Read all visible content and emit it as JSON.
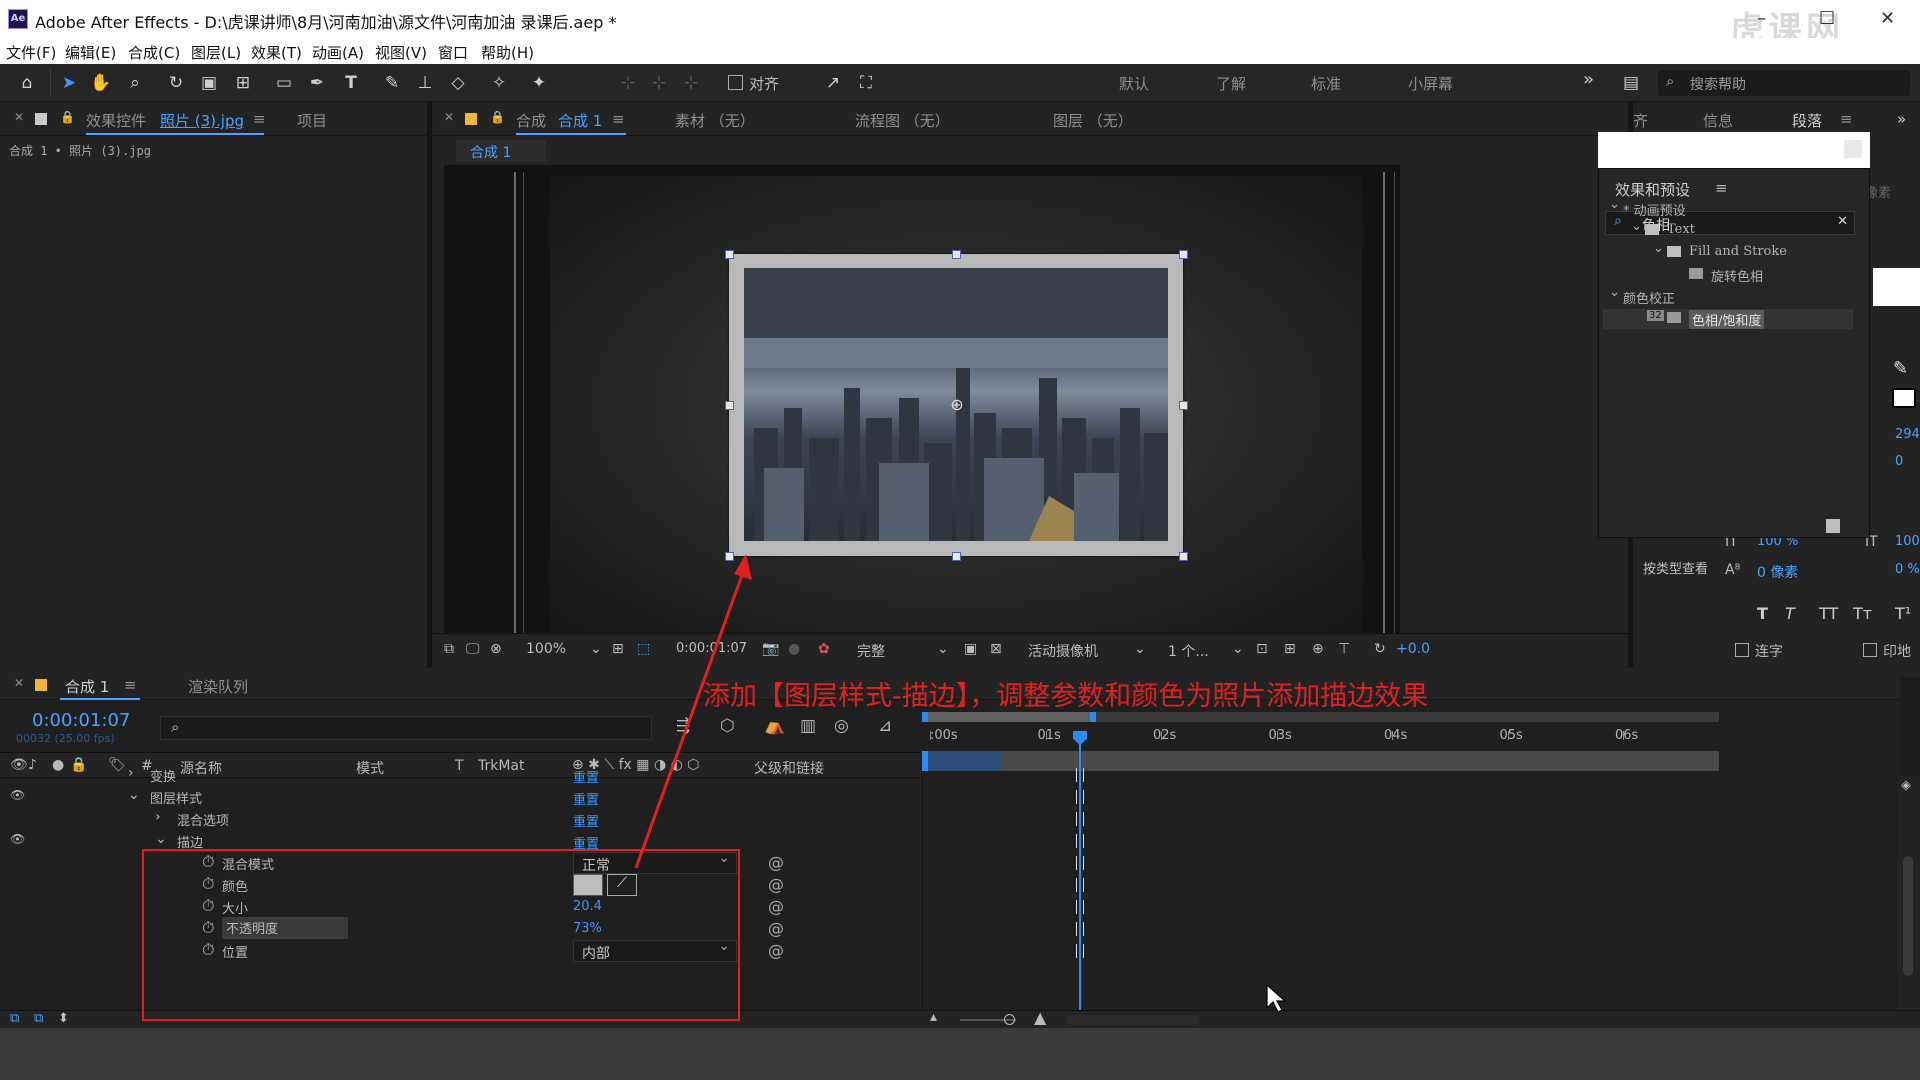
{
  "window": {
    "app_icon": "Ae",
    "title": "Adobe After Effects - D:\\虎课讲师\\8月\\河南加油\\源文件\\河南加油 录课后.aep *",
    "watermark": "虎课网"
  },
  "menu": [
    "文件(F)",
    "编辑(E)",
    "合成(C)",
    "图层(L)",
    "效果(T)",
    "动画(A)",
    "视图(V)",
    "窗口",
    "帮助(H)"
  ],
  "toolbar": {
    "align_label": "对齐",
    "workspaces": [
      "默认",
      "了解",
      "标准",
      "小屏幕"
    ],
    "search_placeholder": "搜索帮助",
    "more": "»"
  },
  "effect_controls": {
    "tab_prefix": "效果控件",
    "tab_layer": "照片 (3).jpg",
    "tab_project": "项目",
    "breadcrumb": "合成 1 • 照片 (3).jpg"
  },
  "composition": {
    "tab_prefix": "合成",
    "tab_name": "合成 1",
    "other_tabs": [
      "素材 （无）",
      "流程图 （无）",
      "图层 （无）"
    ],
    "subtab": "合成 1",
    "zoom": "100%",
    "timecode": "0:00:01:07",
    "resolution": "完整",
    "camera": "活动摄像机",
    "views": "1 个...",
    "exposure": "+0.0"
  },
  "right_panel": {
    "tabs": [
      "齐",
      "信息",
      "段落"
    ],
    "effects_title": "效果和预设",
    "search_value": "色相",
    "tree": [
      {
        "label": "* 动画预设",
        "indent": 0,
        "arrow": "⌄"
      },
      {
        "label": "Text",
        "indent": 1,
        "arrow": "⌄",
        "folder": true
      },
      {
        "label": "Fill and Stroke",
        "indent": 2,
        "arrow": "⌄",
        "folder": true
      },
      {
        "label": "旋转色相",
        "indent": 3,
        "arrow": "",
        "fx": true
      },
      {
        "label": "颜色校正",
        "indent": 0,
        "arrow": "⌄"
      },
      {
        "label": "色相/饱和度",
        "indent": 2,
        "arrow": "",
        "fx": true,
        "selected": true,
        "bitdepth": "32"
      }
    ],
    "char_values": {
      "leading": "294",
      "kern": "0",
      "vscale": "100 %",
      "hscale": "100",
      "baseline": "0 像素",
      "tsume": "0 %"
    },
    "search_hint": "按类型查看",
    "ligature": "连字",
    "hindi": "印地",
    "side_label": "像素"
  },
  "timeline": {
    "tab": "合成 1",
    "render_queue": "渲染队列",
    "timecode": "0:00:01:07",
    "frame_info": "00032 (25.00 fps)",
    "columns": {
      "num": "#",
      "source": "源名称",
      "mode": "模式",
      "t": "T",
      "trkmat": "TrkMat",
      "parent": "父级和链接"
    },
    "ruler_labels": [
      ":00s",
      "01s",
      "02s",
      "03s",
      "04s",
      "05s",
      "06s"
    ],
    "rows": [
      {
        "name": "变换",
        "indent": 1,
        "arrow": "›",
        "value": "重置",
        "eye": false
      },
      {
        "name": "图层样式",
        "indent": 1,
        "arrow": "⌄",
        "value": "重置",
        "eye": true
      },
      {
        "name": "混合选项",
        "indent": 2,
        "arrow": "›",
        "value": "重置",
        "eye": false
      },
      {
        "name": "描边",
        "indent": 2,
        "arrow": "⌄",
        "value": "重置",
        "eye": true
      },
      {
        "name": "混合模式",
        "indent": 3,
        "stopwatch": true,
        "dropdown": "正常"
      },
      {
        "name": "颜色",
        "indent": 3,
        "stopwatch": true,
        "color": "#bdbdbd"
      },
      {
        "name": "大小",
        "indent": 3,
        "stopwatch": true,
        "value": "20.4"
      },
      {
        "name": "不透明度",
        "indent": 3,
        "stopwatch": true,
        "value": "73%",
        "highlight": true
      },
      {
        "name": "位置",
        "indent": 3,
        "stopwatch": true,
        "dropdown": "内部"
      }
    ]
  },
  "annotation": "添加【图层样式-描边】，调整参数和颜色为照片添加描边效果",
  "colors": {
    "accent": "#4aa3ff",
    "annotation": "#e02121",
    "playhead": "#2d8cf0"
  }
}
